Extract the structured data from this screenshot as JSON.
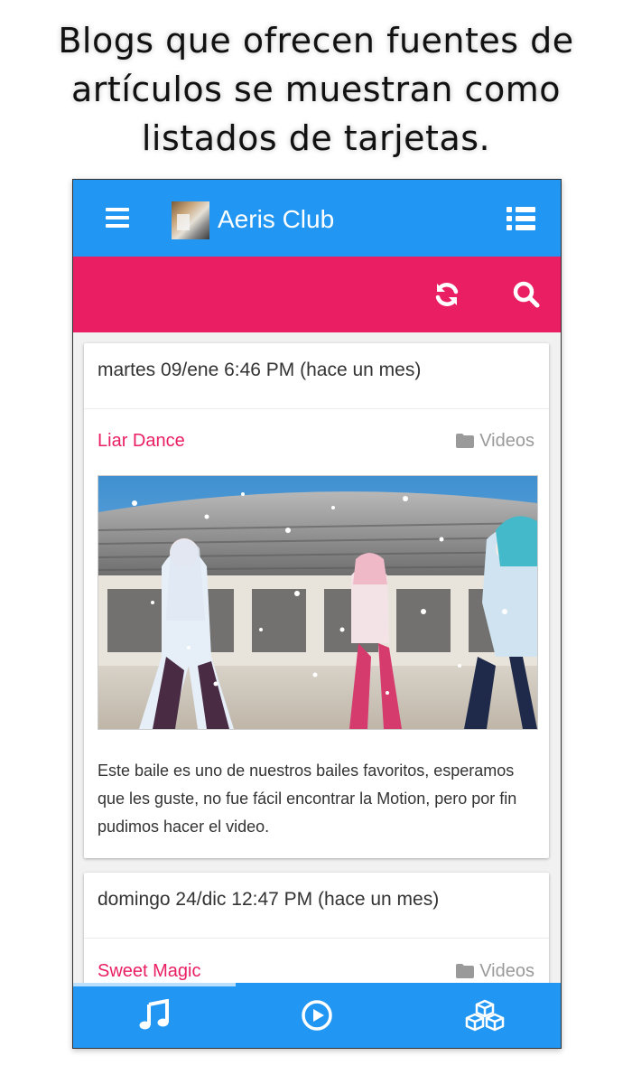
{
  "promo": {
    "line1": "Blogs que ofrecen fuentes de",
    "line2": "artículos se muestran como",
    "line3": "listados de tarjetas."
  },
  "appbar": {
    "title": "Aeris Club",
    "color": "#2196f3",
    "left_icon": "menu-icon",
    "right_icon": "list-icon"
  },
  "toolbar": {
    "color": "#e91e63",
    "icons": [
      "refresh-icon",
      "search-icon"
    ]
  },
  "posts": [
    {
      "date": "martes 09/ene 6:46 PM (hace un mes)",
      "title": "Liar Dance",
      "category": "Videos",
      "excerpt": "Este baile es uno de nuestros bailes favoritos, esperamos que les guste, no fue fácil encontrar la Motion, pero por fin pudimos hacer el video."
    },
    {
      "date": "domingo 24/dic 12:47 PM (hace un mes)",
      "title": "Sweet Magic",
      "category": "Videos"
    }
  ],
  "bottom_nav": {
    "items": [
      "music-icon",
      "play-circle-icon",
      "cubes-icon"
    ],
    "active_index": 0
  }
}
